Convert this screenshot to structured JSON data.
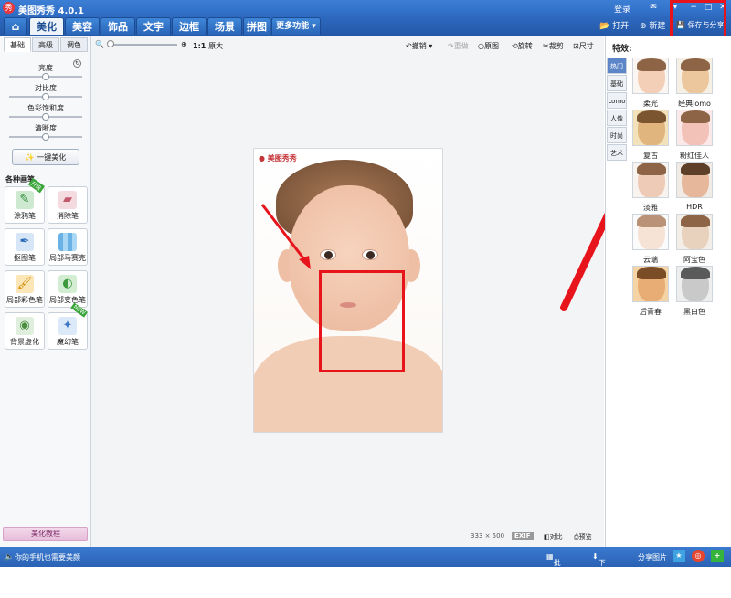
{
  "window": {
    "title": "美图秀秀 4.0.1",
    "login": "登录"
  },
  "tabs": {
    "home_icon": "home-icon",
    "items": [
      {
        "label": "美化"
      },
      {
        "label": "美容"
      },
      {
        "label": "饰品"
      },
      {
        "label": "文字"
      },
      {
        "label": "边框"
      },
      {
        "label": "场景"
      },
      {
        "label": "拼图"
      },
      {
        "label": "更多功能"
      }
    ]
  },
  "top_actions": {
    "open": "打开",
    "new": "新建",
    "save_share": "保存与分享"
  },
  "edit_toolbar": {
    "zoom_ratio": "1:1",
    "original_size": "原大",
    "undo": "撤销",
    "redo": "重做",
    "original": "原图",
    "rotate": "旋转",
    "crop": "裁剪",
    "size": "尺寸"
  },
  "left_panel": {
    "subtabs": [
      "基础",
      "高级",
      "调色"
    ],
    "sliders": [
      {
        "label": "亮度",
        "value": 0.5
      },
      {
        "label": "对比度",
        "value": 0.5
      },
      {
        "label": "色彩饱和度",
        "value": 0.5
      },
      {
        "label": "清晰度",
        "value": 0.5
      }
    ],
    "one_key_button": "一键美化",
    "brushes_title": "各种画笔",
    "brushes": [
      {
        "label": "涂鸦笔",
        "tag": "升级"
      },
      {
        "label": "消除笔",
        "tag": ""
      },
      {
        "label": "抠图笔",
        "tag": ""
      },
      {
        "label": "局部马赛克",
        "tag": ""
      },
      {
        "label": "局部彩色笔",
        "tag": ""
      },
      {
        "label": "局部变色笔",
        "tag": ""
      },
      {
        "label": "背景虚化",
        "tag": ""
      },
      {
        "label": "魔幻笔",
        "tag": "NEW"
      }
    ],
    "tutorial": "美化教程"
  },
  "canvas": {
    "watermark": "美图秀秀",
    "dimensions": "333 × 500",
    "exif": "EXIF",
    "compare": "对比",
    "preview": "预览"
  },
  "right_panel": {
    "title": "特效:",
    "categories": [
      "热门",
      "基础",
      "Lomo",
      "人像",
      "时尚",
      "艺术"
    ],
    "effects": [
      {
        "label": "柔光"
      },
      {
        "label": "经典lomo"
      },
      {
        "label": "复古"
      },
      {
        "label": "粉红佳人"
      },
      {
        "label": "淡雅"
      },
      {
        "label": "HDR"
      },
      {
        "label": "云端"
      },
      {
        "label": "阿宝色"
      },
      {
        "label": "后青春"
      },
      {
        "label": "黑白色"
      }
    ]
  },
  "statusbar": {
    "promo": "你的手机也需要美颜",
    "batch": "批处理",
    "download": "下载管理",
    "share": "分享图片"
  },
  "colors": {
    "titlebar": "#2f6cc4",
    "accent_red": "#e8141c"
  }
}
